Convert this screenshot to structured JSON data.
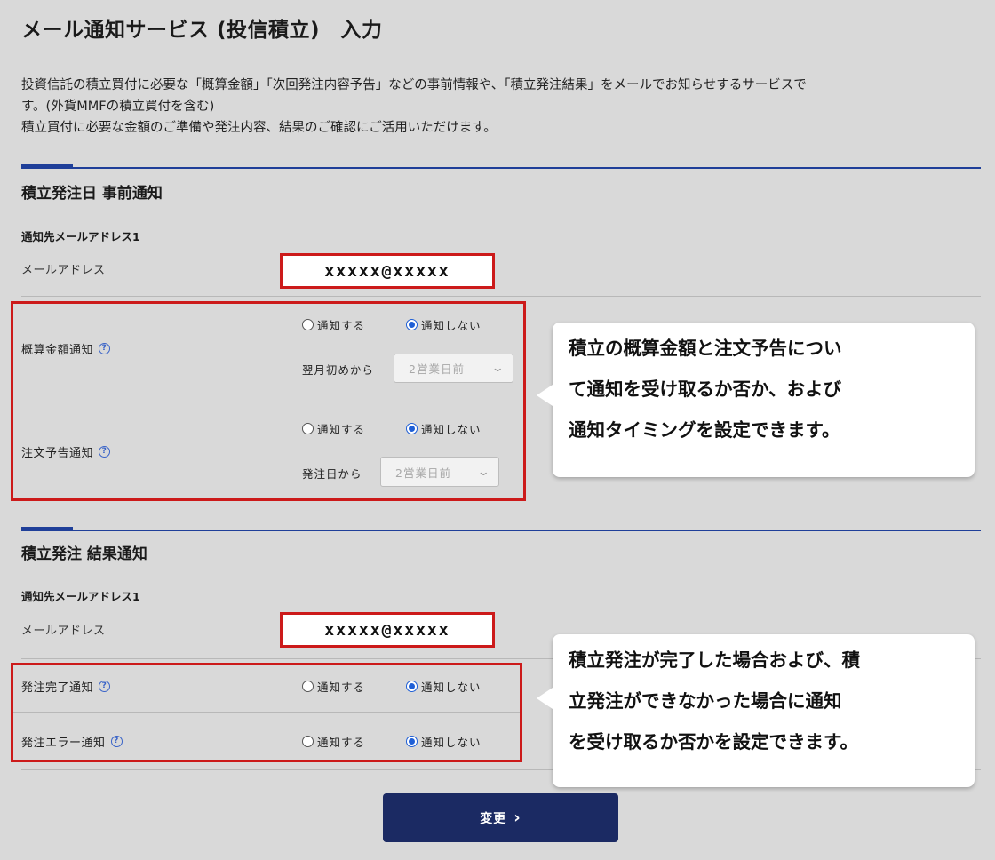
{
  "page": {
    "title": "メール通知サービス (投信積立)　入力",
    "intro": [
      "投資信託の積立買付に必要な「概算金額」「次回発注内容予告」などの事前情報や、「積立発注結果」をメールでお知らせするサービスで",
      "す。(外貨MMFの積立買付を含む)",
      "積立買付に必要な金額のご準備や発注内容、結果のご確認にご活用いただけます。"
    ]
  },
  "section_advance": {
    "title": "積立発注日 事前通知",
    "address_heading": "通知先メールアドレス1",
    "email_label": "メールアドレス",
    "email_value": "xxxxx@xxxxx",
    "estimate": {
      "label": "概算金額通知",
      "option_on": "通知する",
      "option_off": "通知しない",
      "selected": "通知しない",
      "timing_label": "翌月初めから",
      "timing_value": "2営業日前"
    },
    "preview": {
      "label": "注文予告通知",
      "option_on": "通知する",
      "option_off": "通知しない",
      "selected": "通知しない",
      "timing_label": "発注日から",
      "timing_value": "2営業日前"
    }
  },
  "section_result": {
    "title": "積立発注 結果通知",
    "address_heading": "通知先メールアドレス1",
    "email_label": "メールアドレス",
    "email_value": "xxxxx@xxxxx",
    "complete": {
      "label": "発注完了通知",
      "option_on": "通知する",
      "option_off": "通知しない",
      "selected": "通知しない"
    },
    "error": {
      "label": "発注エラー通知",
      "option_on": "通知する",
      "option_off": "通知しない",
      "selected": "通知しない"
    }
  },
  "callouts": {
    "advance": [
      "積立の概算金額と注文予告につい",
      "て通知を受け取るか否か、および",
      "通知タイミングを設定できます。"
    ],
    "result": [
      "積立発注が完了した場合および、積",
      "立発注ができなかった場合に通知",
      "を受け取るか否かを設定できます。"
    ]
  },
  "submit": {
    "label": "変更",
    "icon": "chevron-right-icon"
  },
  "help_icon_glyph": "?",
  "colors": {
    "background": "#d9d9d9",
    "accent_blue": "#1f3f99",
    "highlight_red": "#cc1a1a",
    "button_navy": "#1b2a63",
    "radio_blue": "#1f5fd6"
  }
}
